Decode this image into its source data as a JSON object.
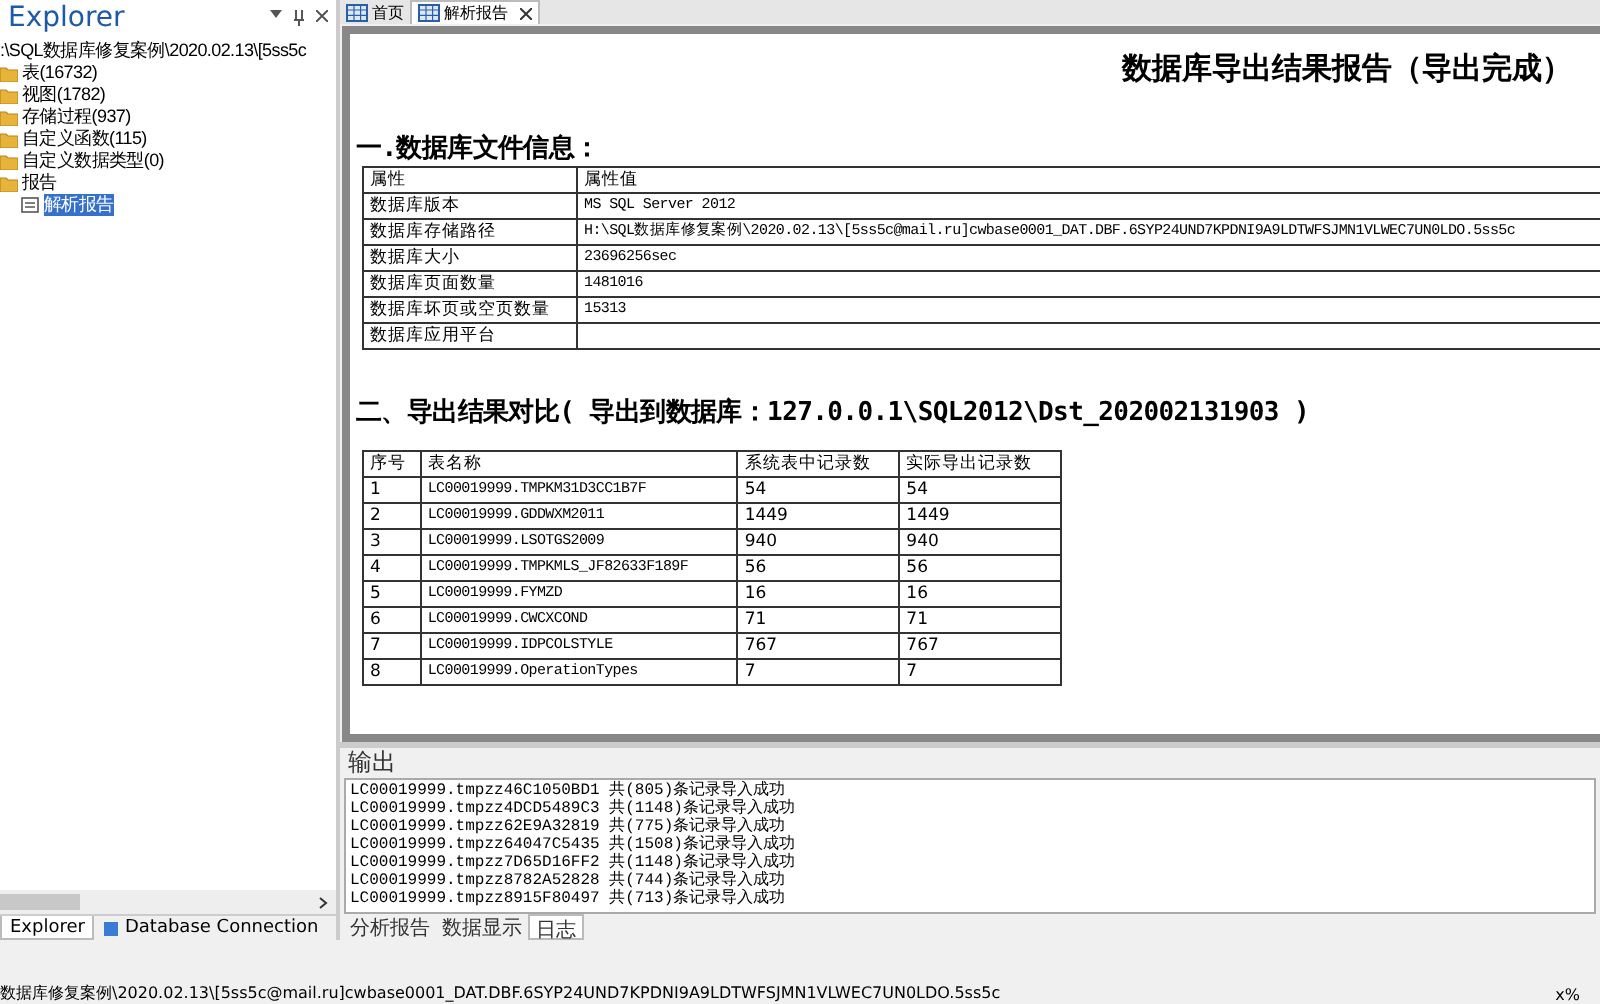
{
  "explorer": {
    "title": "Explorer",
    "tree": [
      {
        "label": ":\\SQL数据库修复案例\\2020.02.13\\[5ss5c",
        "selected": false,
        "children": [
          {
            "label": "表(16732)",
            "selected": false
          },
          {
            "label": "视图(1782)",
            "selected": false
          },
          {
            "label": "存储过程(937)",
            "selected": false
          },
          {
            "label": "自定义函数(115)",
            "selected": false
          },
          {
            "label": "自定义数据类型(0)",
            "selected": false
          },
          {
            "label": "报告",
            "selected": false,
            "children": [
              {
                "label": "解析报告",
                "selected": true
              }
            ]
          }
        ]
      }
    ],
    "tabs": [
      {
        "label": "Explorer",
        "selected": true
      },
      {
        "label": "Database Connection",
        "selected": false
      }
    ]
  },
  "doc_tabs": [
    {
      "label": "首页",
      "selected": false,
      "closable": false
    },
    {
      "label": "解析报告",
      "selected": true,
      "closable": true
    }
  ],
  "report": {
    "title": "数据库导出结果报告（导出完成）",
    "section_1": "一.数据库文件信息：",
    "info_columns": [
      "属性",
      "属性值"
    ],
    "info_rows": [
      [
        "数据库版本",
        "MS SQL Server 2012"
      ],
      [
        "数据库存储路径",
        "H:\\SQL数据库修复案例\\2020.02.13\\[5ss5c@mail.ru]cwbase0001_DAT.DBF.6SYP24UND7KPDNI9A9LDTWFSJMN1VLWEC7UN0LDO.5ss5c"
      ],
      [
        "数据库大小",
        "23696256sec"
      ],
      [
        "数据库页面数量",
        "1481016"
      ],
      [
        "数据库坏页或空页数量",
        "15313"
      ],
      [
        "数据库应用平台",
        ""
      ]
    ],
    "section_2": "二、导出结果对比( 导出到数据库：127.0.0.1\\SQL2012\\Dst_202002131903 )",
    "result_columns": [
      "序号",
      "表名称",
      "系统表中记录数",
      "实际导出记录数"
    ],
    "result_rows": [
      [
        "1",
        "LC00019999.TMPKM31D3CC1B7F",
        "54",
        "54"
      ],
      [
        "2",
        "LC00019999.GDDWXM2011",
        "1449",
        "1449"
      ],
      [
        "3",
        "LC00019999.LSOTGS2009",
        "940",
        "940"
      ],
      [
        "4",
        "LC00019999.TMPKMLS_JF82633F189F",
        "56",
        "56"
      ],
      [
        "5",
        "LC00019999.FYMZD",
        "16",
        "16"
      ],
      [
        "6",
        "LC00019999.CWCXCOND",
        "71",
        "71"
      ],
      [
        "7",
        "LC00019999.IDPCOLSTYLE",
        "767",
        "767"
      ],
      [
        "8",
        "LC00019999.OperationTypes",
        "7",
        "7"
      ]
    ]
  },
  "output": {
    "title": "输出",
    "lines": [
      "LC00019999.tmpzz46C1050BD1 共(805)条记录导入成功",
      "LC00019999.tmpzz4DCD5489C3 共(1148)条记录导入成功",
      "LC00019999.tmpzz62E9A32819 共(775)条记录导入成功",
      "LC00019999.tmpzz64047C5435 共(1508)条记录导入成功",
      "LC00019999.tmpzz7D65D16FF2 共(1148)条记录导入成功",
      "LC00019999.tmpzz8782A52828 共(744)条记录导入成功",
      "LC00019999.tmpzz8915F80497 共(713)条记录导入成功"
    ],
    "tabs": [
      {
        "label": "分析报告",
        "selected": false
      },
      {
        "label": "数据显示",
        "selected": false
      },
      {
        "label": "日志",
        "selected": true
      }
    ]
  },
  "status_bar": {
    "path": "数据库修复案例\\2020.02.13\\[5ss5c@mail.ru]cwbase0001_DAT.DBF.6SYP24UND7KPDNI9A9LDTWFSJMN1VLWEC7UN0LDO.5ss5c",
    "zoom": "x%"
  }
}
